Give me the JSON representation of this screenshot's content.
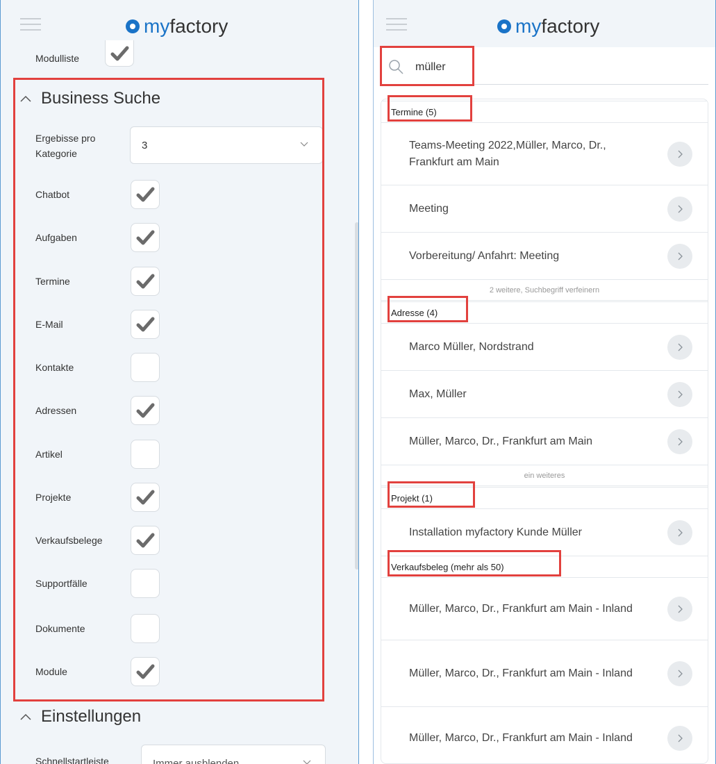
{
  "brand": {
    "my": "my",
    "factory": "factory"
  },
  "left": {
    "top_item": {
      "label": "Modulliste",
      "checked": true
    },
    "business_section": {
      "title": "Business Suche",
      "per_category_label": "Ergebisse pro Kategorie",
      "per_category_value": "3",
      "items": [
        {
          "label": "Chatbot",
          "checked": true
        },
        {
          "label": "Aufgaben",
          "checked": true
        },
        {
          "label": "Termine",
          "checked": true
        },
        {
          "label": "E-Mail",
          "checked": true
        },
        {
          "label": "Kontakte",
          "checked": false
        },
        {
          "label": "Adressen",
          "checked": true
        },
        {
          "label": "Artikel",
          "checked": false
        },
        {
          "label": "Projekte",
          "checked": true
        },
        {
          "label": "Verkaufsbelege",
          "checked": true
        },
        {
          "label": "Supportfälle",
          "checked": false
        },
        {
          "label": "Dokumente",
          "checked": false
        },
        {
          "label": "Module",
          "checked": true
        }
      ]
    },
    "settings_section": {
      "title": "Einstellungen",
      "first_label": "Schnellstartleiste",
      "first_value": "Immer ausblenden"
    }
  },
  "right": {
    "search": {
      "value": "müller"
    },
    "categories": [
      {
        "title": "Termine (5)",
        "items": [
          "Teams-Meeting 2022,Müller, Marco, Dr., Frankfurt am Main",
          "Meeting",
          "Vorbereitung/ Anfahrt: Meeting"
        ],
        "more": "2 weitere, Suchbegriff verfeinern"
      },
      {
        "title": "Adresse (4)",
        "items": [
          "Marco Müller, Nordstrand",
          "Max, Müller",
          "Müller, Marco, Dr., Frankfurt am Main"
        ],
        "more": "ein weiteres"
      },
      {
        "title": "Projekt (1)",
        "items": [
          "Installation myfactory Kunde Müller"
        ],
        "more": ""
      },
      {
        "title": "Verkaufsbeleg (mehr als 50)",
        "items": [
          "Müller, Marco, Dr., Frankfurt am Main - Inland",
          "Müller, Marco, Dr., Frankfurt am Main - Inland",
          "Müller, Marco, Dr., Frankfurt am Main - Inland"
        ],
        "more": ""
      }
    ]
  },
  "colors": {
    "accent": "#1a73c7",
    "highlight": "#e2413e",
    "check": "#6b6b6b"
  }
}
